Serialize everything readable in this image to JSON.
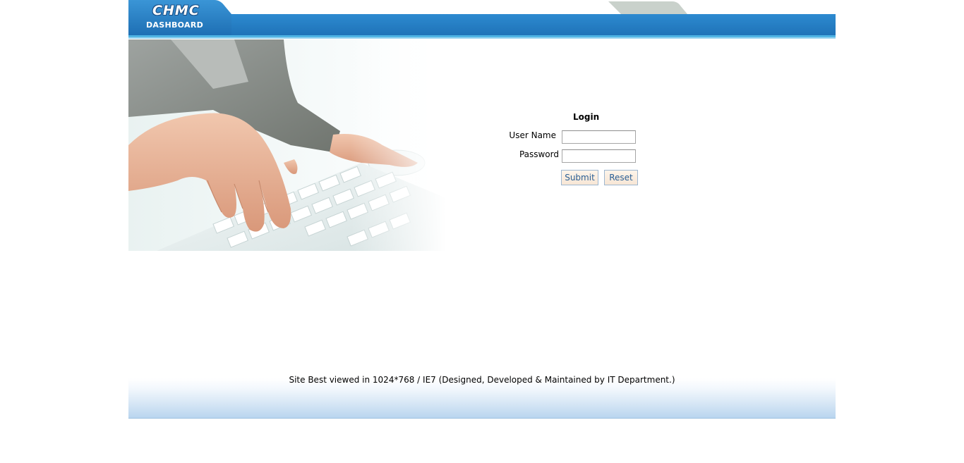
{
  "header": {
    "logo_text": "CHMC",
    "subtitle": "DASHBOARD"
  },
  "login": {
    "title": "Login",
    "username_label": "User Name",
    "password_label": "Password",
    "username_value": "",
    "password_value": "",
    "submit_label": "Submit",
    "reset_label": "Reset"
  },
  "footer": {
    "text": "Site Best viewed in 1024*768 / IE7 (Designed, Developed & Maintained by IT Department.)"
  },
  "colors": {
    "header_blue": "#2580c3",
    "header_tab_gray": "#c4ccc6",
    "button_text": "#2a5f95",
    "footer_blue": "#b9d5ef"
  }
}
